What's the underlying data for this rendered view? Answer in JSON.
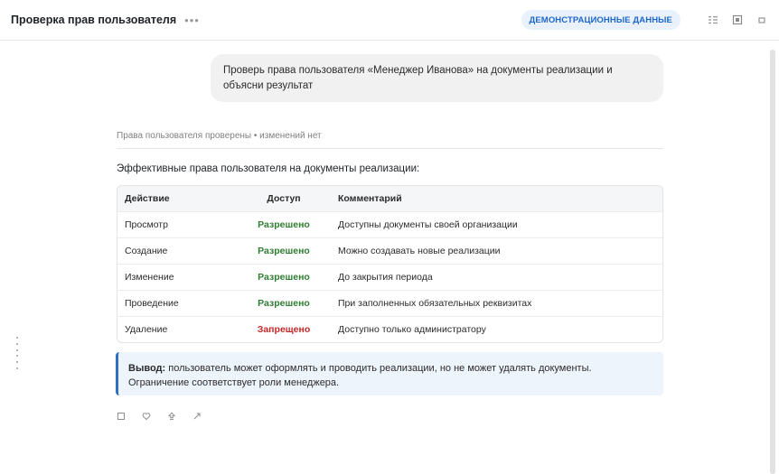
{
  "header": {
    "title": "Проверка прав пользователя",
    "more": "•••",
    "badge": "ДЕМОНСТРАЦИОННЫЕ ДАННЫЕ",
    "icons": [
      "list-icon",
      "panel-icon",
      "square-icon"
    ]
  },
  "user_message": "Проверь права пользователя «Менеджер Иванова» на документы реализации и объясни результат",
  "response": {
    "status": "Права пользователя проверены • изменений нет",
    "intro": "Эффективные права пользователя на документы реализации:",
    "table": {
      "columns": [
        "Действие",
        "Доступ",
        "Комментарий"
      ],
      "rows": [
        {
          "action": "Просмотр",
          "access": "Разрешено",
          "comment": "Доступны документы своей организации",
          "allowed": true
        },
        {
          "action": "Создание",
          "access": "Разрешено",
          "comment": "Можно создавать новые реализации",
          "allowed": true
        },
        {
          "action": "Изменение",
          "access": "Разрешено",
          "comment": "До закрытия периода",
          "allowed": true
        },
        {
          "action": "Проведение",
          "access": "Разрешено",
          "comment": "При заполненных обязательных реквизитах",
          "allowed": true
        },
        {
          "action": "Удаление",
          "access": "Запрещено",
          "comment": "Доступно только администратору",
          "allowed": false
        }
      ]
    },
    "conclusion_label": "Вывод:",
    "conclusion_text": " пользователь может оформлять и проводить реализации, но не может удалять документы. Ограничение соответствует роли менеджера."
  },
  "message_actions": [
    "copy-icon",
    "like-icon",
    "dislike-icon",
    "share-icon"
  ],
  "colors": {
    "accent": "#2e6ec3",
    "allowed": "#2f7d32",
    "denied": "#c62828",
    "badge_bg": "#e9f1fc"
  }
}
